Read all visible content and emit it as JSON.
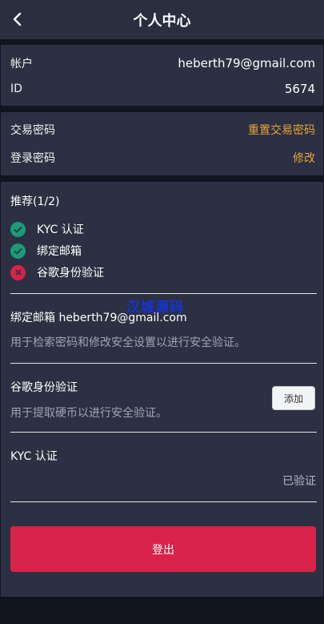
{
  "header": {
    "title": "个人中心",
    "back_icon": "chevron-left-icon"
  },
  "account": {
    "account_label": "帐户",
    "account_value": "heberth79@gmail.com",
    "id_label": "ID",
    "id_value": "5674"
  },
  "passwords": {
    "trade_label": "交易密码",
    "trade_action": "重置交易密码",
    "login_label": "登录密码",
    "login_action": "修改"
  },
  "recommend": {
    "title": "推荐(1/2)",
    "items": [
      {
        "label": "KYC 认证",
        "status": "done",
        "icon": "check-circle-icon"
      },
      {
        "label": "绑定邮箱",
        "status": "done",
        "icon": "check-circle-icon"
      },
      {
        "label": "谷歌身份验证",
        "status": "missing",
        "icon": "x-circle-icon"
      }
    ]
  },
  "watermark": "汉城源码",
  "email_section": {
    "title": "绑定邮箱 heberth79@gmail.com",
    "desc": "用于检索密码和修改安全设置以进行安全验证。"
  },
  "google_section": {
    "title": "谷歌身份验证",
    "desc": "用于提取硬币以进行安全验证。",
    "button": "添加"
  },
  "kyc_section": {
    "title": "KYC 认证",
    "status": "已验证"
  },
  "logout": "登出",
  "colors": {
    "background": "#12151f",
    "card": "#2c3042",
    "accent_link": "#e8a33a",
    "success": "#1a9c78",
    "danger": "#d8234a"
  }
}
